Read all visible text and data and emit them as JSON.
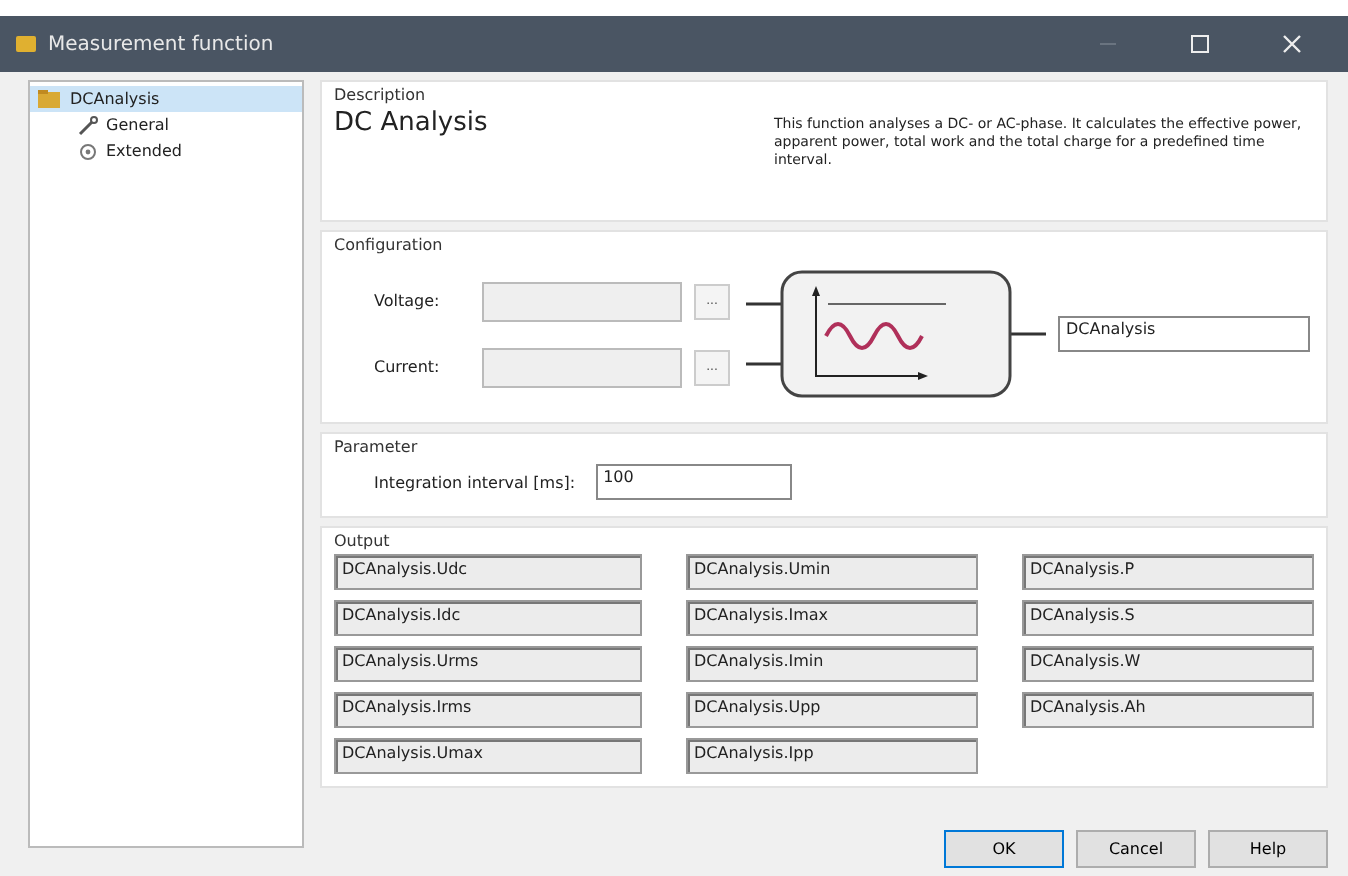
{
  "window": {
    "title": "Measurement function"
  },
  "tree": [
    {
      "label": "DCAnalysis",
      "selected": true,
      "children": [
        {
          "label": "General",
          "selected": false
        },
        {
          "label": "Extended",
          "selected": false
        }
      ]
    }
  ],
  "description": {
    "title": "Description",
    "name": "DC Analysis",
    "text": "This function analyses a DC- or AC-phase. It calculates the effective power, apparent power, total work and the total charge for a predefined time interval."
  },
  "configuration": {
    "title": "Configuration",
    "inputs": [
      {
        "label": "Voltage:",
        "browse": "..."
      },
      {
        "label": "Current:",
        "browse": "..."
      }
    ],
    "output_name": "DCAnalysis"
  },
  "parameter": {
    "title": "Parameter",
    "label": "Integration interval [ms]:",
    "value": "100"
  },
  "output": {
    "title": "Output",
    "columns": [
      [
        "DCAnalysis.Udc",
        "DCAnalysis.Idc",
        "DCAnalysis.Urms",
        "DCAnalysis.Irms",
        "DCAnalysis.Umax"
      ],
      [
        "DCAnalysis.Umin",
        "DCAnalysis.Imax",
        "DCAnalysis.Imin",
        "DCAnalysis.Upp",
        "DCAnalysis.Ipp"
      ],
      [
        "DCAnalysis.P",
        "DCAnalysis.S",
        "DCAnalysis.W",
        "DCAnalysis.Ah"
      ]
    ]
  },
  "buttons": [
    {
      "label": "OK",
      "default": true
    },
    {
      "label": "Cancel",
      "default": false
    },
    {
      "label": "Help",
      "default": false
    }
  ]
}
